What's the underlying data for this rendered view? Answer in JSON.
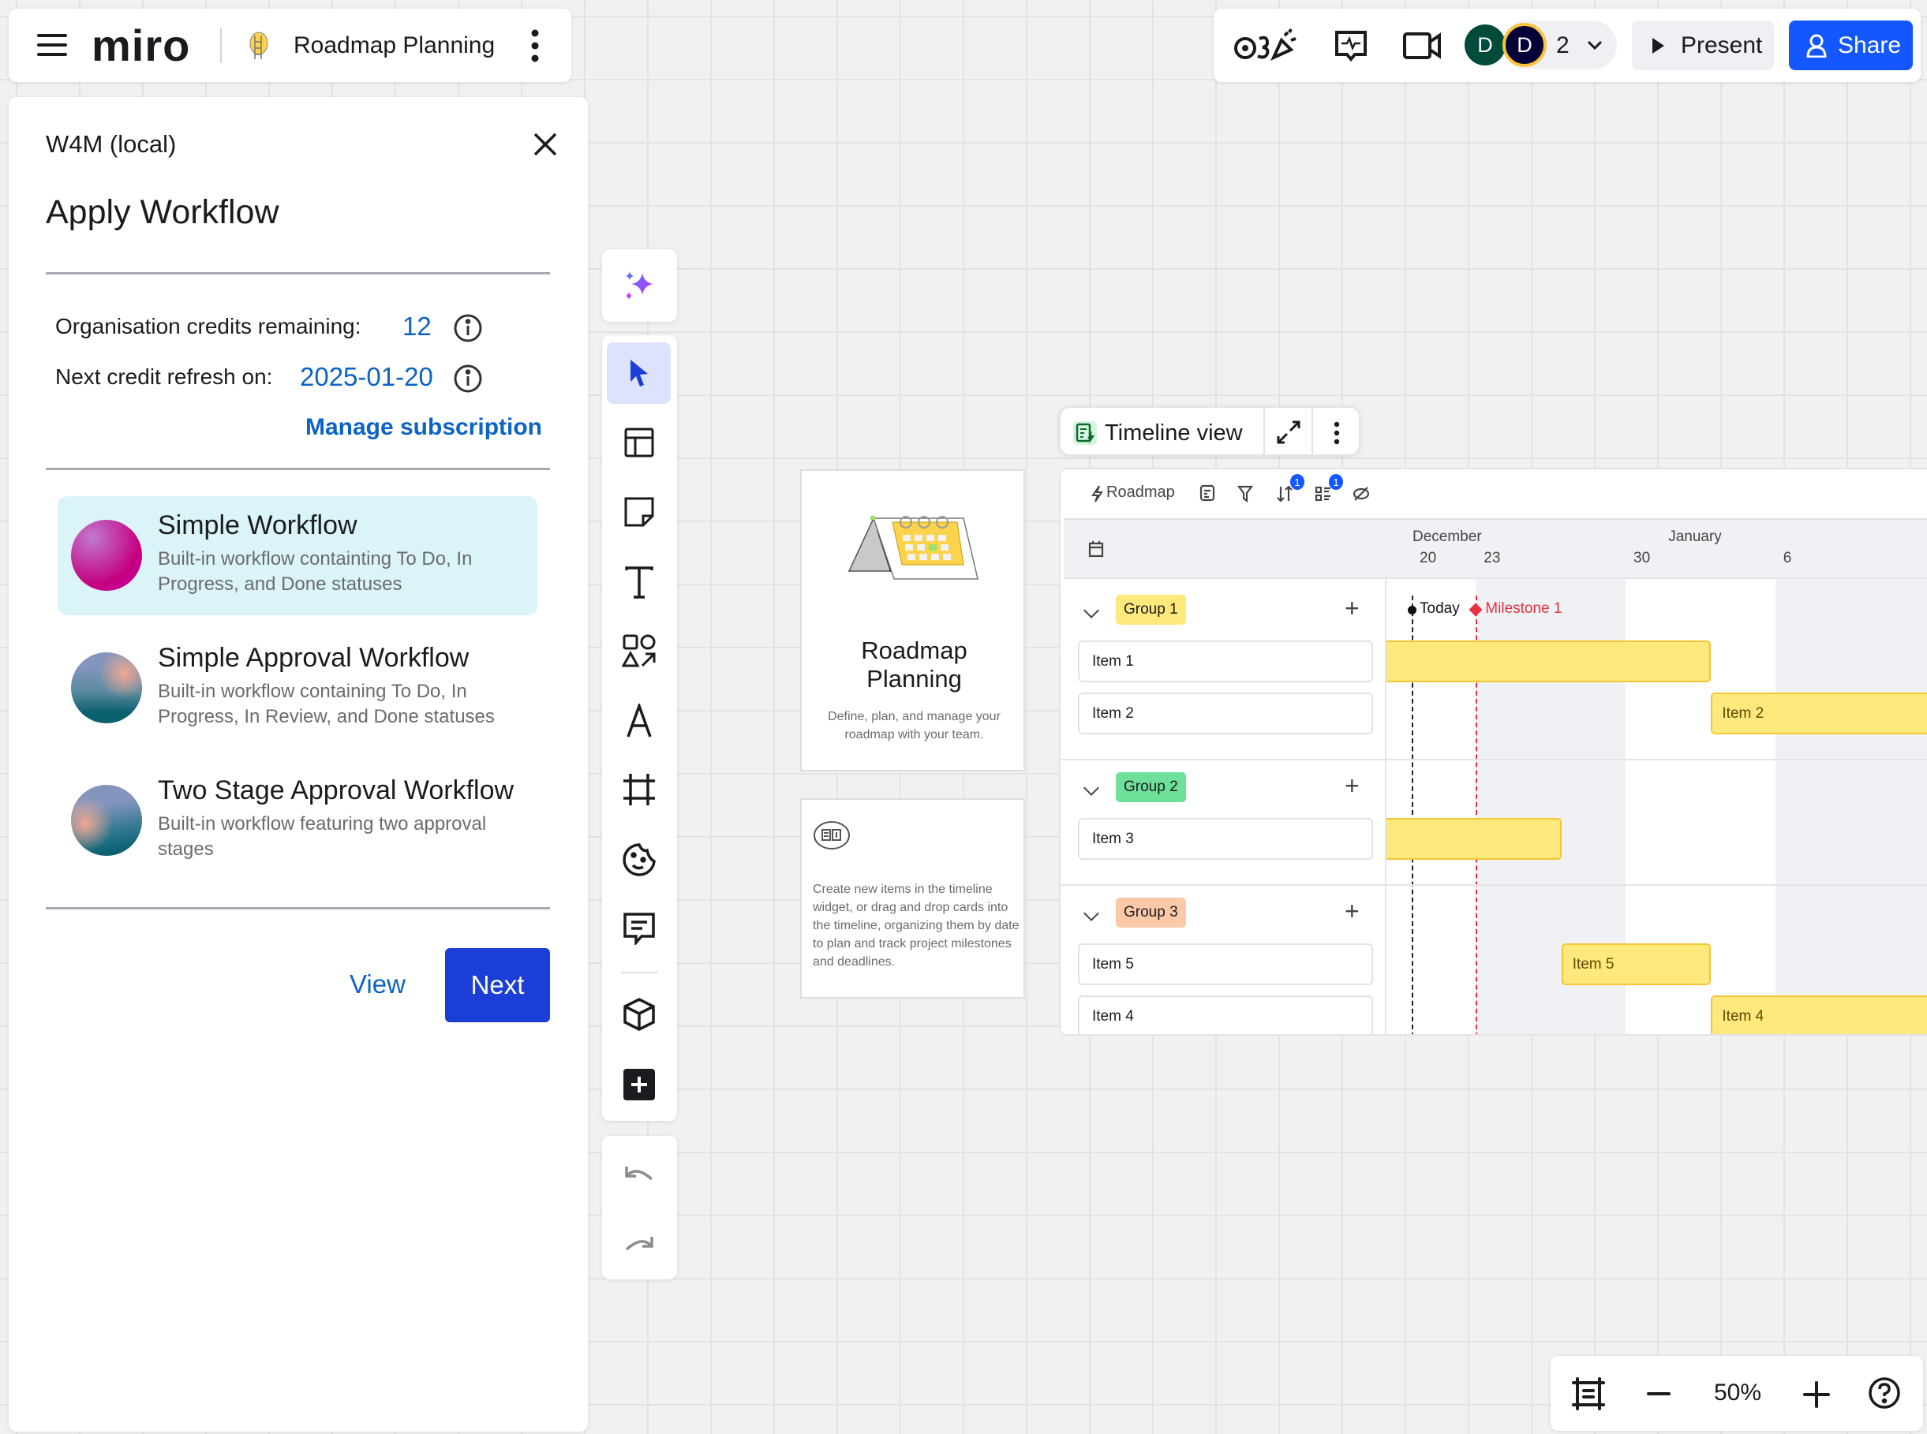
{
  "app": {
    "logo": "miro",
    "board_title": "Roadmap Planning",
    "menu_icon": "hamburger-icon",
    "more_icon": "kebab-icon"
  },
  "topbar": {
    "reactions_icon": "reactions-icon",
    "activity_icon": "activity-icon",
    "video_icon": "video-camera-icon",
    "avatars": [
      {
        "initial": "D",
        "color": "#004b3a"
      },
      {
        "initial": "D",
        "color": "#050038",
        "ring": "#fcc33d"
      }
    ],
    "collaborator_count": "2",
    "present_label": "Present",
    "share_label": "Share",
    "accent": "#1456ff"
  },
  "panel": {
    "app_name": "W4M (local)",
    "title": "Apply Workflow",
    "credits_label": "Organisation credits remaining:",
    "credits_value": "12",
    "refresh_label": "Next credit refresh on:",
    "refresh_value": "2025-01-20",
    "manage_link": "Manage subscription",
    "workflows": [
      {
        "title": "Simple Workflow",
        "desc": "Built-in workflow containting To Do, In Progress, and Done statuses",
        "selected": true
      },
      {
        "title": "Simple Approval Workflow",
        "desc": "Built-in workflow containing To Do, In Progress, In Review, and Done statuses",
        "selected": false
      },
      {
        "title": "Two Stage Approval Workflow",
        "desc": "Built-in workflow featuring two approval stages",
        "selected": false
      }
    ],
    "view_label": "View",
    "next_label": "Next",
    "link_color": "#0b63c5",
    "next_color": "#1a3ed6"
  },
  "toolbar": {
    "tools": [
      "ai-sparkle",
      "select",
      "templates",
      "sticky-note",
      "text",
      "shapes",
      "pen",
      "frame",
      "stickers",
      "comment",
      "3d-apps",
      "more-apps"
    ],
    "active": "select",
    "undo": "undo",
    "redo": "redo"
  },
  "cards": {
    "title": "Roadmap Planning",
    "subtitle": "Define, plan, and manage your roadmap with your team.",
    "help_text": "Create new items in the timeline widget, or drag and drop cards into the timeline, organizing them by date to plan and track project milestones and deadlines."
  },
  "timeline": {
    "header_label": "Timeline view",
    "source_label": "Roadmap",
    "sort_badge": "1",
    "group_badge": "1",
    "months": [
      {
        "label": "December"
      },
      {
        "label": "January"
      }
    ],
    "ticks": [
      "20",
      "23",
      "30",
      "6"
    ],
    "today_label": "Today",
    "milestone_label": "Milestone 1",
    "milestone_color": "#e5323e",
    "groups": [
      {
        "label": "Group 1",
        "color": "#ffe87c",
        "items": [
          {
            "label": "Item 1",
            "start": null,
            "end": "Jan 3",
            "show_label": false
          },
          {
            "label": "Item 2",
            "start": "Jan 3",
            "end": null,
            "show_label": true
          }
        ]
      },
      {
        "label": "Group 2",
        "color": "#6ee09a",
        "items": [
          {
            "label": "Item 3",
            "start": null,
            "end": "Dec 27",
            "show_label": false
          }
        ]
      },
      {
        "label": "Group 3",
        "color": "#fbc9a8",
        "items": [
          {
            "label": "Item 5",
            "start": "Dec 27",
            "end": "Jan 3",
            "show_label": true
          },
          {
            "label": "Item 4",
            "start": "Jan 3",
            "end": null,
            "show_label": true
          }
        ]
      }
    ]
  },
  "zoom": {
    "level": "50%"
  }
}
